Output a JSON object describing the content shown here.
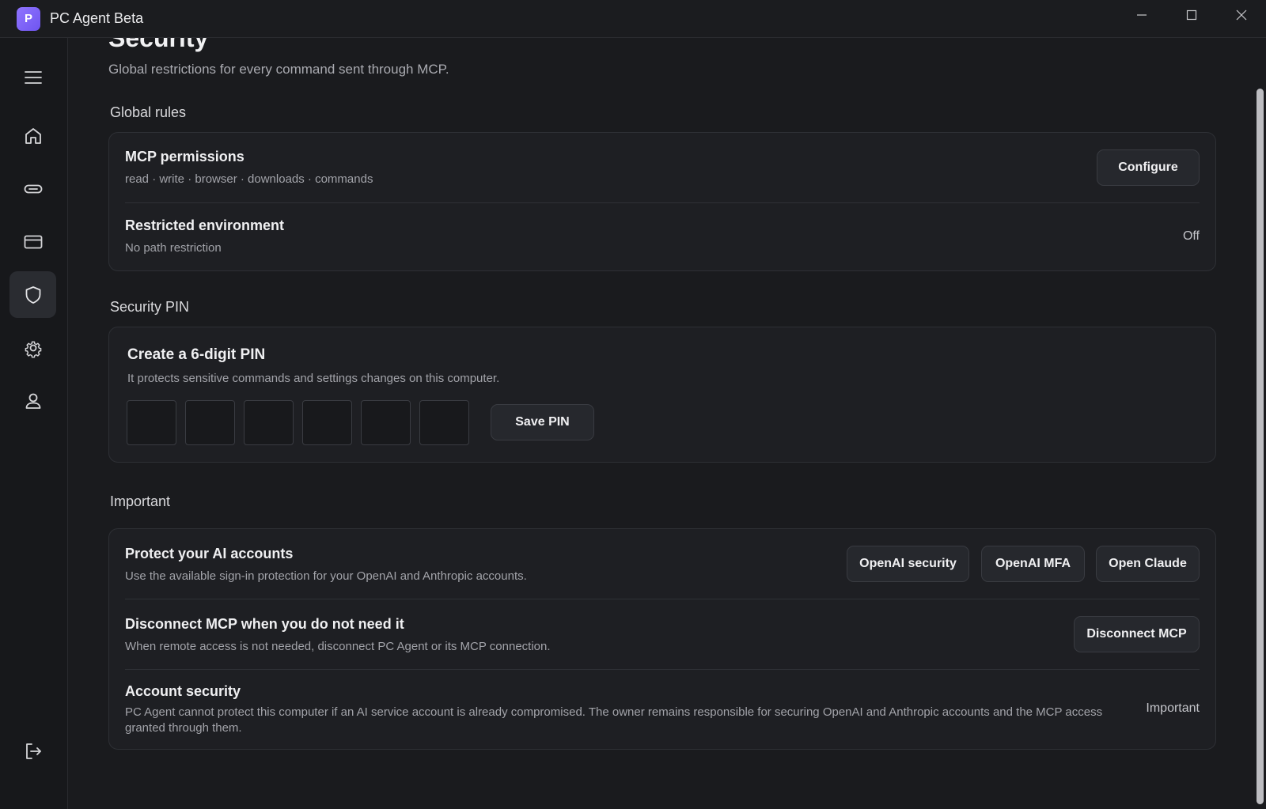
{
  "app": {
    "logo_letter": "P",
    "title": "PC Agent Beta"
  },
  "sidebar": {
    "items": [
      {
        "name": "menu",
        "icon": "hamburger-icon"
      },
      {
        "name": "home",
        "icon": "home-icon"
      },
      {
        "name": "connections",
        "icon": "link-icon"
      },
      {
        "name": "billing",
        "icon": "card-icon"
      },
      {
        "name": "security",
        "icon": "shield-icon",
        "active": true
      },
      {
        "name": "settings",
        "icon": "gear-icon"
      },
      {
        "name": "account",
        "icon": "user-icon"
      },
      {
        "name": "logout",
        "icon": "logout-icon"
      }
    ]
  },
  "page": {
    "title": "Security",
    "subtitle": "Global restrictions for every command sent through MCP."
  },
  "global_rules": {
    "label": "Global rules",
    "mcp_permissions": {
      "title": "MCP permissions",
      "desc": "read · write · browser · downloads · commands",
      "button": "Configure"
    },
    "restricted_env": {
      "title": "Restricted environment",
      "desc": "No path restriction",
      "status": "Off"
    }
  },
  "security_pin": {
    "label": "Security PIN",
    "title": "Create a 6-digit PIN",
    "desc": "It protects sensitive commands and settings changes on this computer.",
    "digits": [
      "",
      "",
      "",
      "",
      "",
      ""
    ],
    "button": "Save PIN"
  },
  "important": {
    "label": "Important",
    "protect_accounts": {
      "title": "Protect your AI accounts",
      "desc": "Use the available sign-in protection for your OpenAI and Anthropic accounts.",
      "buttons": [
        "OpenAI security",
        "OpenAI MFA",
        "Open Claude"
      ]
    },
    "disconnect": {
      "title": "Disconnect MCP when you do not need it",
      "desc": "When remote access is not needed, disconnect PC Agent or its MCP connection.",
      "button": "Disconnect MCP"
    },
    "account_security": {
      "title": "Account security",
      "desc": "PC Agent cannot protect this computer if an AI service account is already compromised. The owner remains responsible for securing OpenAI and Anthropic accounts and the MCP access granted through them.",
      "status": "Important"
    }
  },
  "colors": {
    "accent": "#7c63f7",
    "background": "#1a1b1e",
    "card": "#1e1f23"
  }
}
